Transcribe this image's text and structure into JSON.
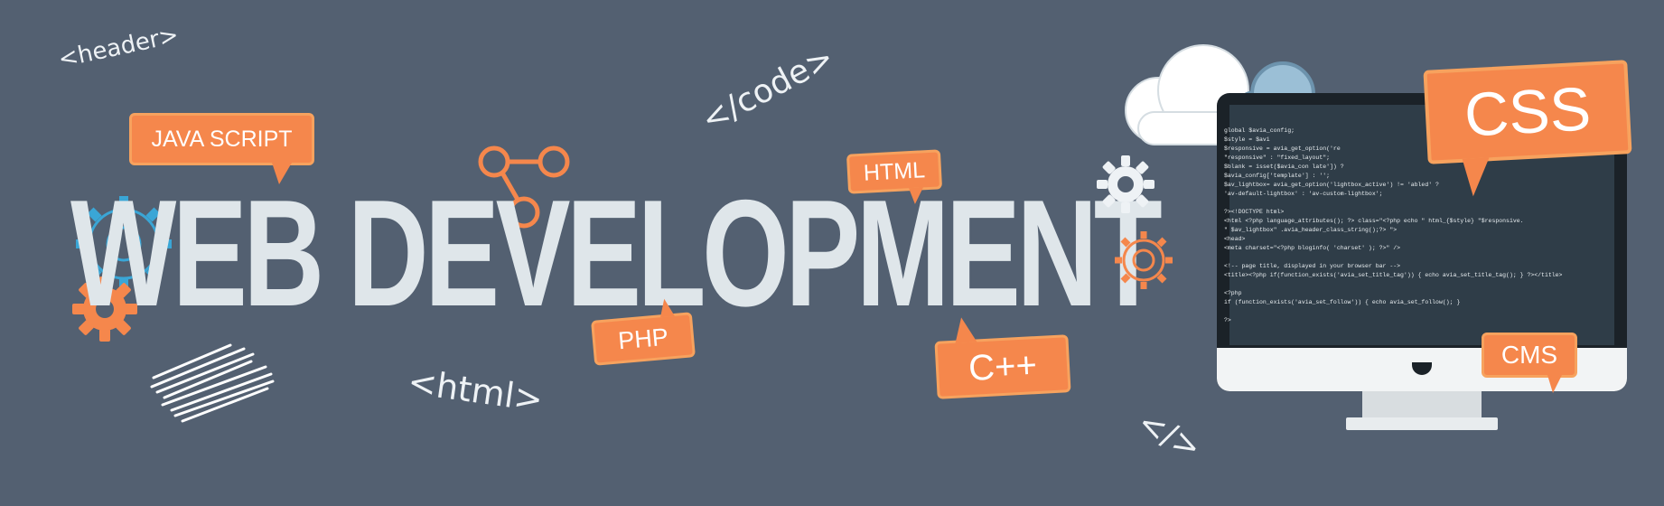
{
  "banner": {
    "background": "#536071",
    "title": "WEB DEVELOPMENT",
    "accent_color": "#f5874c",
    "title_color": "#dfe6ea"
  },
  "tags": {
    "header": "<header>",
    "code": "</code>",
    "html": "<html>",
    "slash": "</>"
  },
  "bubbles": {
    "javascript": "JAVA SCRIPT",
    "html": "HTML",
    "php": "PHP",
    "cpp": "C++",
    "css": "CSS",
    "cms": "CMS"
  },
  "monitor": {
    "code_lines": [
      "global $avia_config;",
      "$style                     = $avi",
      "$responsive      = avia_get_option('re",
      "\"responsive\" : \"fixed_layout\";",
      "$blank                   = isset($avia_con        late']) ?",
      "$avia_config['template'] : '';",
      "             $av_lightbox= avia_get_option('lightbox_active') !=    'abled' ?",
      "'av-default-lightbox' : 'av-custom-lightbox';",
      "",
      "?><!DOCTYPE html>",
      "<html <?php language_attributes(); ?> class=\"<?php echo \" html_{$style} \"$responsive.",
      "\" $av_lightbox\" .avia_header_class_string();?> \">",
      "<head>",
      "<meta charset=\"<?php bloginfo( 'charset' ); ?>\" />",
      "",
      "<!-- page title, displayed in your browser bar -->",
      "<title><?php if(function_exists('avia_set_title_tag')) { echo avia_set_title_tag(); } ?></title>",
      "",
      "<?php",
      " if (function_exists('avia_set_follow')) { echo avia_set_follow(); }",
      "",
      "?>"
    ]
  },
  "icons": [
    "cloud-icon",
    "share-node-icon",
    "gear-icon",
    "code-lines-icon",
    "monitor-icon"
  ]
}
